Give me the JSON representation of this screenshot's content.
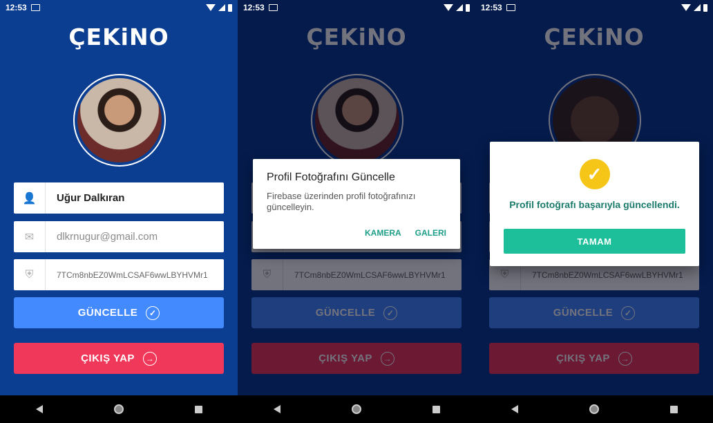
{
  "status": {
    "time": "12:53"
  },
  "app": {
    "logo": "ÇEKiNO"
  },
  "profile": {
    "name": "Uğur Dalkıran",
    "email": "dlkrnugur@gmail.com",
    "uid": "7TCm8nbEZ0WmLCSAF6wwLBYHVMr1"
  },
  "buttons": {
    "update": "GÜNCELLE",
    "logout": "ÇIKIŞ YAP"
  },
  "icons": [
    "user-icon",
    "email-icon",
    "shield-icon",
    "check-circle-icon",
    "exit-icon"
  ],
  "dialog_update": {
    "title": "Profil Fotoğrafını Güncelle",
    "message": "Firebase üzerinden profil fotoğrafınızı güncelleyin.",
    "camera": "KAMERA",
    "gallery": "GALERI"
  },
  "dialog_success": {
    "message": "Profil fotoğrafı başarıyla güncellendi.",
    "ok": "TAMAM"
  },
  "colors": {
    "background": "#0b3d91",
    "update": "#448aff",
    "logout": "#f0385a",
    "accent": "#1dbf9a"
  }
}
